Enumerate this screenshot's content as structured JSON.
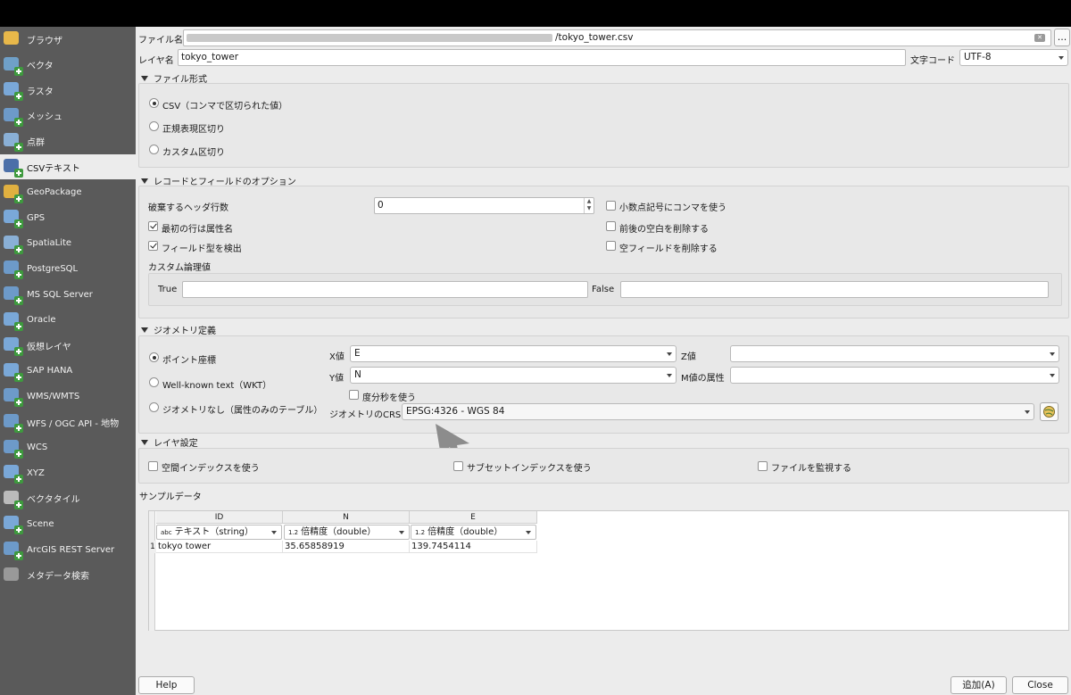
{
  "sidebar": {
    "items": [
      {
        "label": "ブラウザ",
        "icon": "folder-icon",
        "color": "#e8b84a"
      },
      {
        "label": "ベクタ",
        "icon": "vector-icon",
        "color": "#6fa0c8"
      },
      {
        "label": "ラスタ",
        "icon": "raster-icon",
        "color": "#7aa8d8"
      },
      {
        "label": "メッシュ",
        "icon": "mesh-icon",
        "color": "#6d9ac9"
      },
      {
        "label": "点群",
        "icon": "point-cloud-icon",
        "color": "#8ab0d6"
      },
      {
        "label": "CSVテキスト",
        "icon": "csv-text-icon",
        "color": "#4b6fa8"
      },
      {
        "label": "GeoPackage",
        "icon": "geopackage-icon",
        "color": "#e0b040"
      },
      {
        "label": "GPS",
        "icon": "gps-icon",
        "color": "#7aa8d8"
      },
      {
        "label": "SpatiaLite",
        "icon": "spatialite-icon",
        "color": "#8ab0d6"
      },
      {
        "label": "PostgreSQL",
        "icon": "postgresql-icon",
        "color": "#6d9ac9"
      },
      {
        "label": "MS SQL Server",
        "icon": "mssql-icon",
        "color": "#6d9ac9"
      },
      {
        "label": "Oracle",
        "icon": "oracle-icon",
        "color": "#7aa8d8"
      },
      {
        "label": "仮想レイヤ",
        "icon": "virtual-layer-icon",
        "color": "#7aa8d8"
      },
      {
        "label": "SAP HANA",
        "icon": "sap-hana-icon",
        "color": "#7aa8d8"
      },
      {
        "label": "WMS/WMTS",
        "icon": "wms-icon",
        "color": "#6d9ac9"
      },
      {
        "label": "WFS / OGC API - 地物",
        "icon": "wfs-icon",
        "color": "#6d9ac9"
      },
      {
        "label": "WCS",
        "icon": "wcs-icon",
        "color": "#6d9ac9"
      },
      {
        "label": "XYZ",
        "icon": "xyz-icon",
        "color": "#7aa8d8"
      },
      {
        "label": "ベクタタイル",
        "icon": "vector-tile-icon",
        "color": "#bbbbbb"
      },
      {
        "label": "Scene",
        "icon": "scene-icon",
        "color": "#7aa8d8"
      },
      {
        "label": "ArcGIS REST Server",
        "icon": "arcgis-icon",
        "color": "#6d9ac9"
      },
      {
        "label": "メタデータ検索",
        "icon": "metadata-search-icon",
        "color": "#999999"
      }
    ],
    "active_index": 5
  },
  "file": {
    "label": "ファイル名",
    "path_visible": "/tokyo_tower.csv",
    "browse_label": "…"
  },
  "layer": {
    "label": "レイヤ名",
    "value": "tokyo_tower",
    "encoding_label": "文字コード",
    "encoding_value": "UTF-8"
  },
  "file_format": {
    "title": "ファイル形式",
    "options": [
      {
        "label": "CSV（コンマで区切られた値）",
        "selected": true
      },
      {
        "label": "正規表現区切り",
        "selected": false
      },
      {
        "label": "カスタム区切り",
        "selected": false
      }
    ]
  },
  "record_options": {
    "title": "レコードとフィールドのオプション",
    "skip_header_label": "破棄するヘッダ行数",
    "skip_header_value": "0",
    "first_row_label": "最初の行は属性名",
    "detect_types_label": "フィールド型を検出",
    "decimal_comma_label": "小数点記号にコンマを使う",
    "trim_label": "前後の空白を削除する",
    "discard_empty_label": "空フィールドを削除する",
    "custom_bool_label": "カスタム論理値",
    "true_label": "True",
    "false_label": "False",
    "true_value": "",
    "false_value": ""
  },
  "geometry": {
    "title": "ジオメトリ定義",
    "options": [
      {
        "label": "ポイント座標",
        "selected": true
      },
      {
        "label": "Well-known text（WKT）",
        "selected": false
      },
      {
        "label": "ジオメトリなし（属性のみのテーブル）",
        "selected": false
      }
    ],
    "x_label": "X値",
    "x_value": "E",
    "y_label": "Y値",
    "y_value": "N",
    "z_label": "Z値",
    "z_value": "",
    "m_label": "M値の属性",
    "m_value": "",
    "dms_label": "度分秒を使う",
    "crs_label": "ジオメトリのCRS",
    "crs_value": "EPSG:4326 - WGS 84"
  },
  "layer_settings": {
    "title": "レイヤ設定",
    "spatial_index_label": "空間インデックスを使う",
    "subset_index_label": "サブセットインデックスを使う",
    "watch_file_label": "ファイルを監視する"
  },
  "sample": {
    "title": "サンプルデータ",
    "columns": [
      {
        "header": "ID",
        "type_prefix": "abc",
        "type": "テキスト（string）"
      },
      {
        "header": "N",
        "type_prefix": "1.2",
        "type": "倍精度（double）"
      },
      {
        "header": "E",
        "type_prefix": "1.2",
        "type": "倍精度（double）"
      }
    ],
    "rows": [
      {
        "num": "1",
        "cells": [
          "tokyo tower",
          "35.65858919",
          "139.7454114"
        ]
      }
    ]
  },
  "buttons": {
    "help": "Help",
    "add": "追加(A)",
    "close": "Close"
  },
  "colors": {
    "sidebar_bg": "#5a5a5a",
    "panel_bg": "#ececec",
    "arrow_annotation": "#8c8c8c"
  }
}
